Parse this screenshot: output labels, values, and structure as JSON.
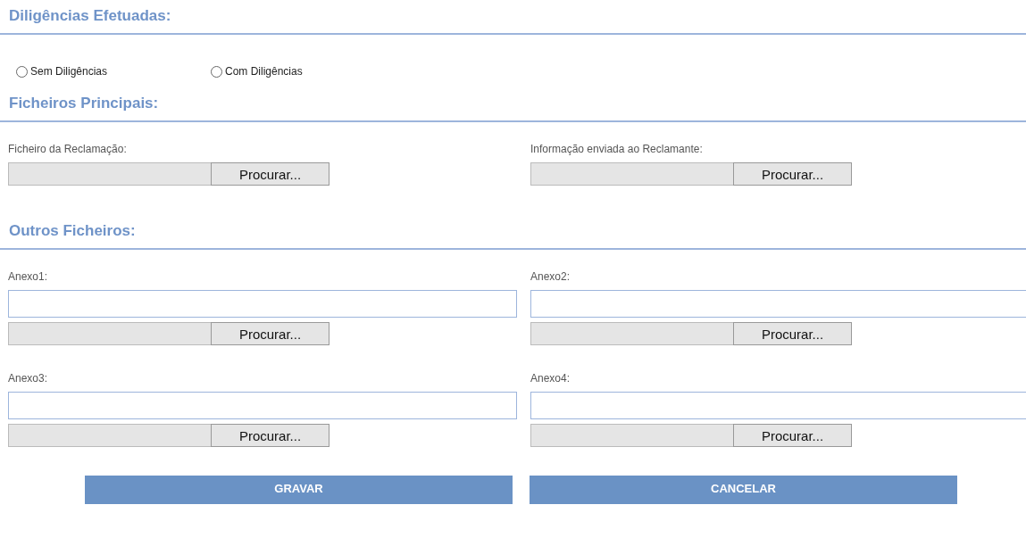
{
  "sections": [
    {
      "kind": "radios",
      "title": "Diligências Efetuadas:",
      "radios": [
        {
          "label": "Sem Diligências",
          "selected": false
        },
        {
          "label": "Com Diligências",
          "selected": false
        }
      ]
    },
    {
      "kind": "files",
      "title": "Ficheiros Principais:",
      "fields": [
        {
          "label": "Ficheiro da Reclamação:",
          "has_text_box": false,
          "button": "Procurar..."
        },
        {
          "label": "Informação enviada ao Reclamante:",
          "has_text_box": false,
          "button": "Procurar..."
        }
      ]
    },
    {
      "kind": "files",
      "title": "Outros Ficheiros:",
      "fields": [
        {
          "label": "Anexo1:",
          "has_text_box": true,
          "button": "Procurar..."
        },
        {
          "label": "Anexo2:",
          "has_text_box": true,
          "button": "Procurar..."
        },
        {
          "label": "Anexo3:",
          "has_text_box": true,
          "button": "Procurar..."
        },
        {
          "label": "Anexo4:",
          "has_text_box": true,
          "button": "Procurar..."
        }
      ]
    }
  ],
  "buttons": [
    "GRAVAR",
    "CANCELAR"
  ]
}
